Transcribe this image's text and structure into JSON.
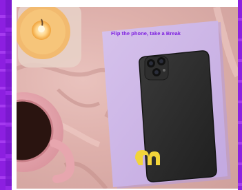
{
  "notebook": {
    "tagline": "Flip the phone, take a Break"
  },
  "colors": {
    "accent_purple": "#8c1fe0",
    "notebook_lilac": "#c9b3e3",
    "phone_black": "#262626",
    "logo_yellow": "#f2d43a",
    "blanket_pink": "#deb0ab",
    "mug_pink": "#e7a6ae"
  },
  "icons": [
    "candle-icon",
    "mug-icon",
    "phone-icon",
    "camera-icon",
    "brand-logo-icon"
  ]
}
